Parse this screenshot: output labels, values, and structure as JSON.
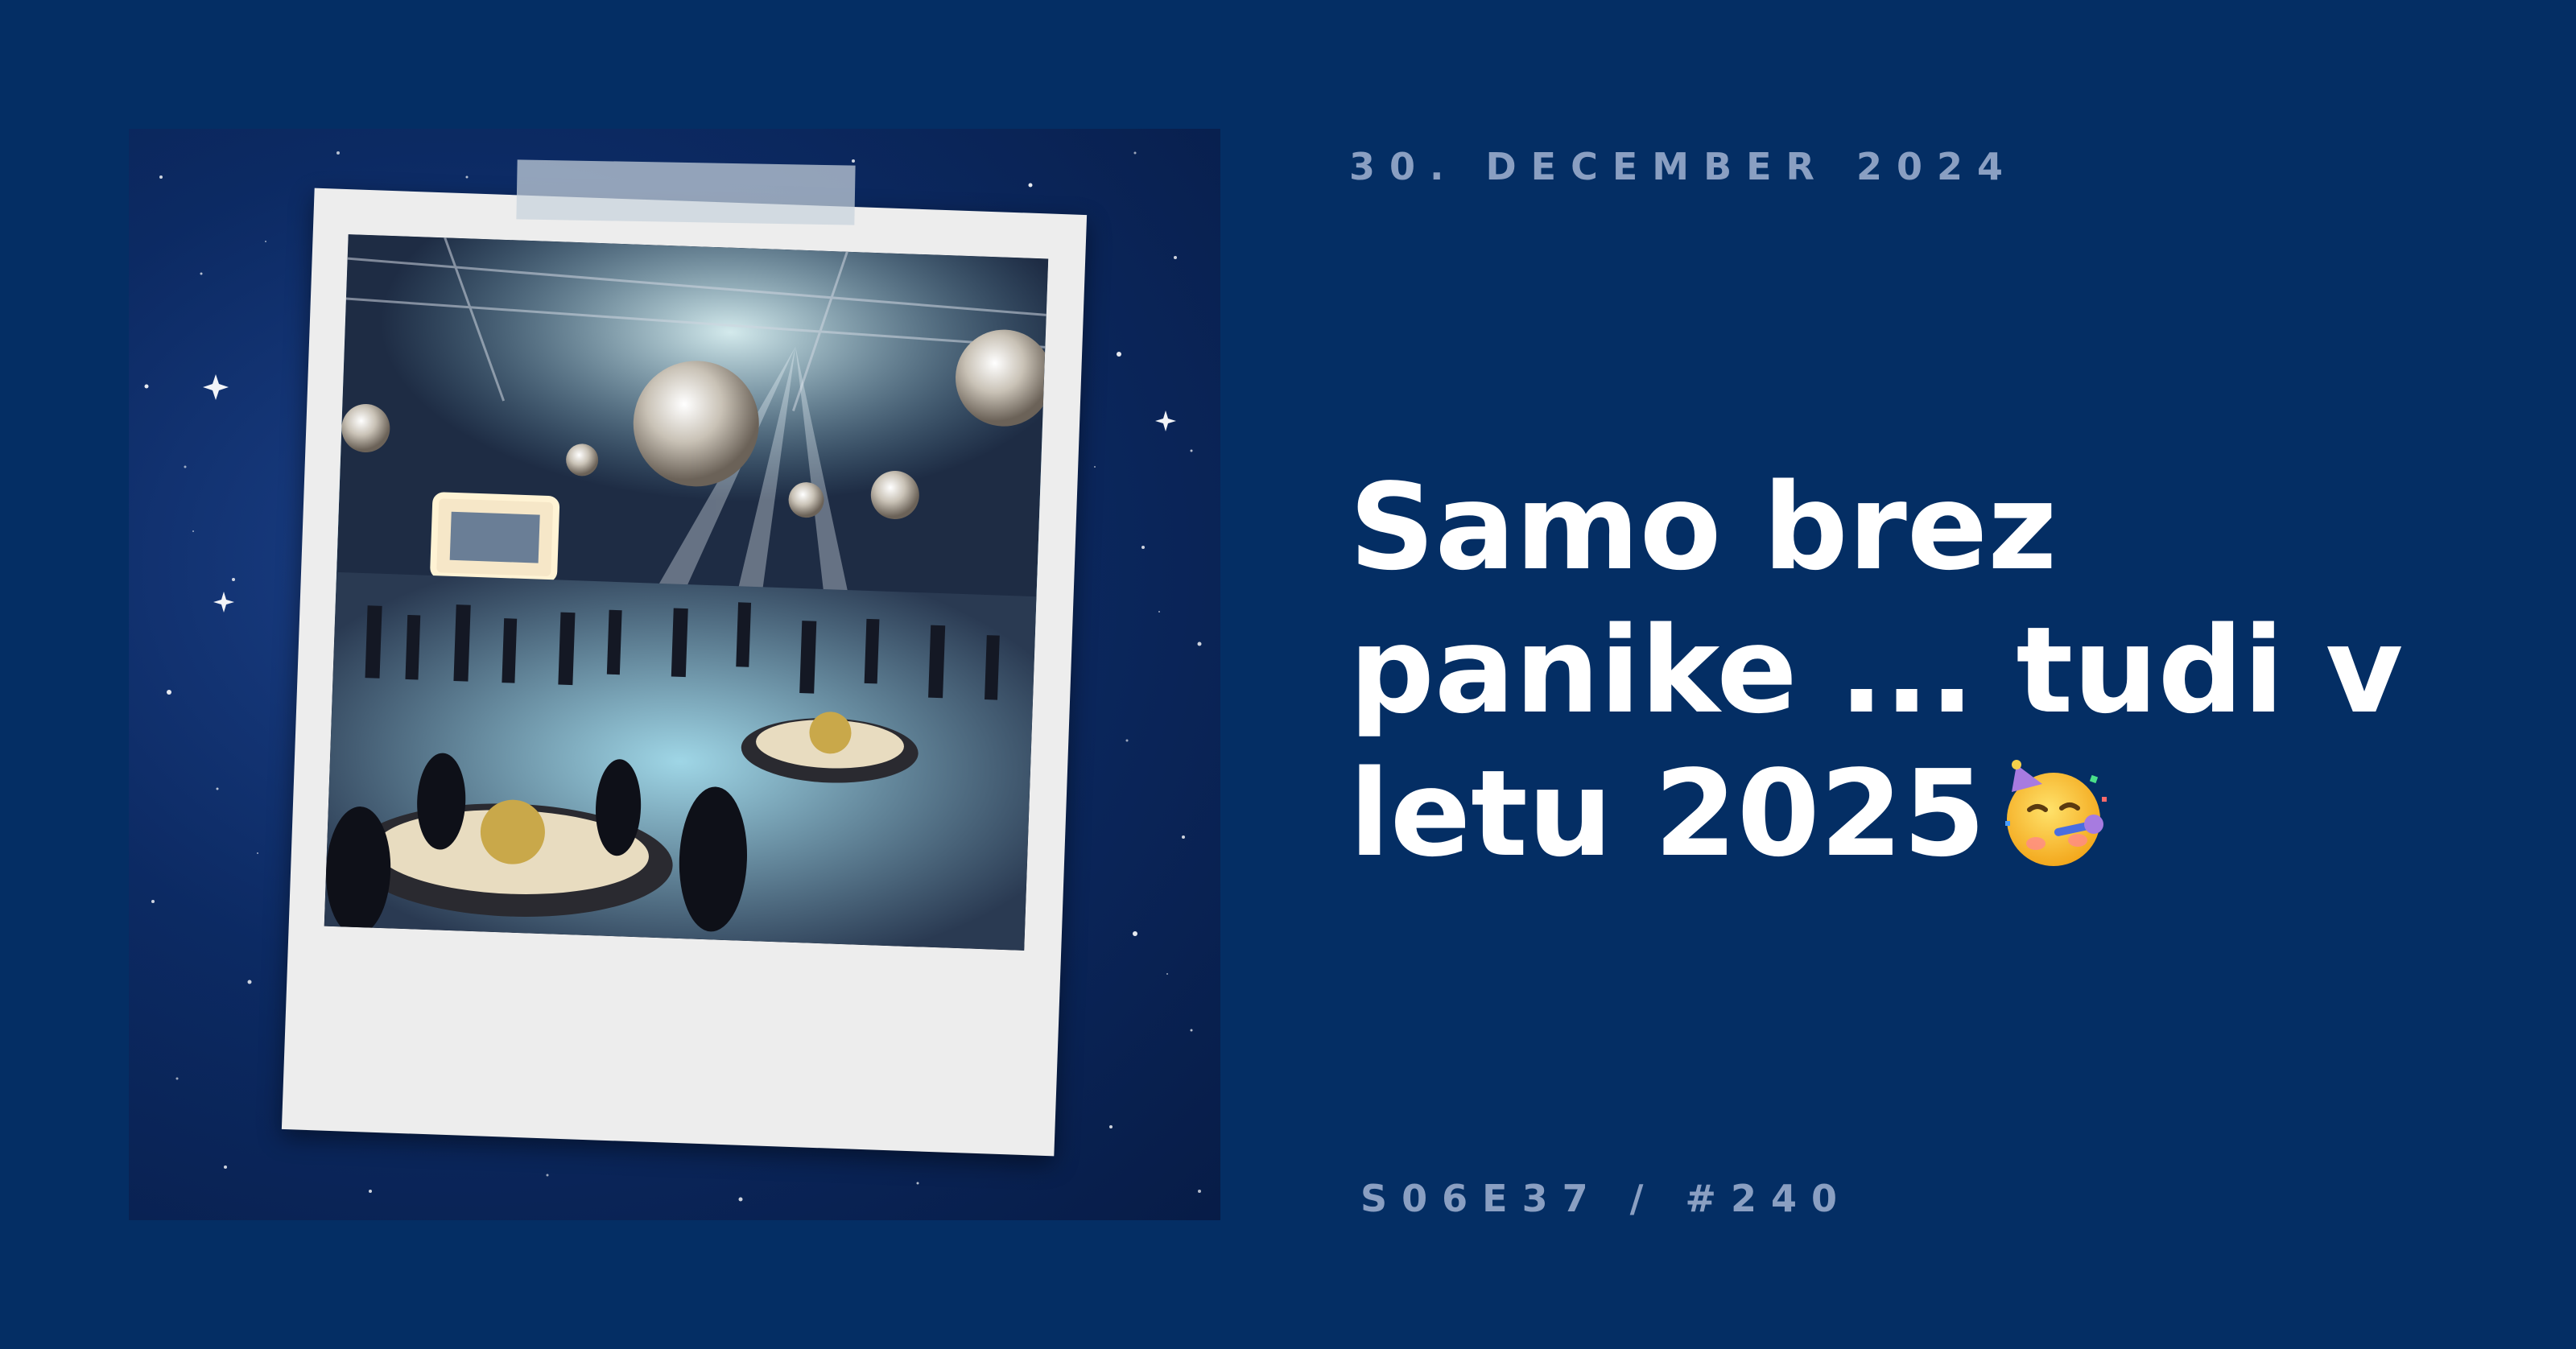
{
  "date": "30. DECEMBER 2024",
  "headline": {
    "text": "Samo brez panike ... tudi v letu 2025",
    "emoji": "party-face-emoji"
  },
  "episode": "S06E37 / #240",
  "colors": {
    "background": "#042e64",
    "headline": "#ffffff",
    "meta": "#8a9fc2"
  },
  "artwork": {
    "icon": "party-photo-polaroid"
  }
}
